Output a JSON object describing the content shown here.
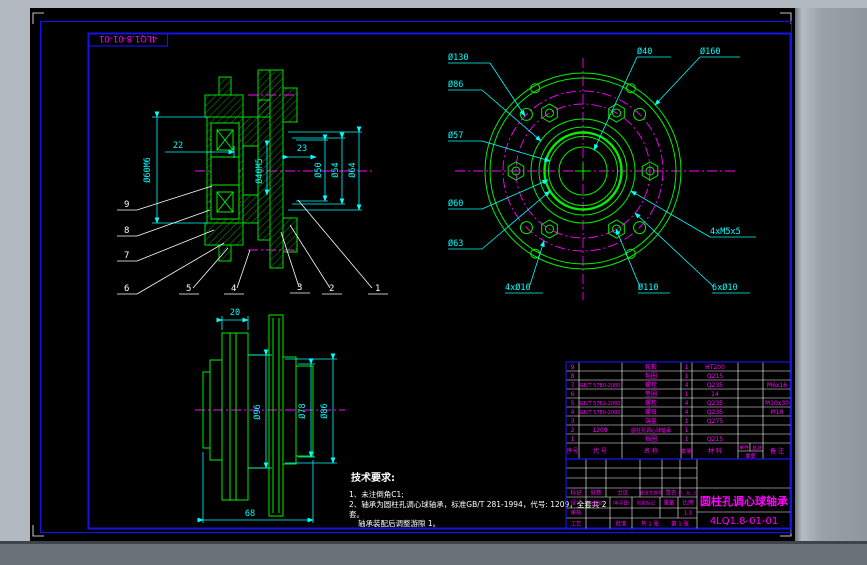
{
  "colors": {
    "line_green": "#00f000",
    "dim_cyan": "#00ffff",
    "center_magenta": "#ff00ff",
    "frame_blue": "#1414e6",
    "annotation_white": "#ffffff",
    "paper_black": "#000000",
    "chrome_gray": "#9aa1a8"
  },
  "frame": {
    "corner_number": "4LQ1.8-01-01"
  },
  "section_view": {
    "dims": {
      "width_22": "22",
      "width_23": "23",
      "bore_left": "Ø60M6",
      "bore_center": "Ø40M5",
      "d50": "Ø50",
      "d54": "Ø54",
      "d64": "Ø64"
    },
    "callouts": [
      "1",
      "2",
      "3",
      "4",
      "5",
      "6",
      "7",
      "8",
      "9"
    ]
  },
  "flange_view": {
    "labels": {
      "d130": "Ø130",
      "d86": "Ø86",
      "d57": "Ø57",
      "d60": "Ø60",
      "d63": "Ø63",
      "d40": "Ø40",
      "d160": "Ø160",
      "thread": "4xM5x5",
      "holes4": "4xØ10",
      "d110": "Ø110",
      "holes6": "6xØ10"
    }
  },
  "bottom_view": {
    "dims": {
      "w20": "20",
      "d96": "Ø96",
      "d78": "Ø78",
      "d86": "Ø86",
      "w68": "68"
    }
  },
  "notes": {
    "title": "技术要求:",
    "line1": "1、未注倒角C1;",
    "line2": "2、轴承为圆柱孔调心球轴承，标准GB/T 281-1994，代号: 1209，全套共 2",
    "line3": "套。",
    "line4": "轴承装配后调整游隙 1。"
  },
  "bom": {
    "headers": {
      "seq": "序号",
      "code": "代 号",
      "name": "名 称",
      "qty": "数量",
      "material": "材 料",
      "unit": "单件",
      "total": "总计",
      "weight": "重量",
      "remark": "备 注"
    },
    "rows": [
      {
        "seq": "9",
        "code": "",
        "name": "轮毂",
        "qty": "1",
        "material": "HT200",
        "remark": ""
      },
      {
        "seq": "8",
        "code": "",
        "name": "毡圈",
        "qty": "1",
        "material": "Q215",
        "remark": ""
      },
      {
        "seq": "7",
        "code": "GB/T 5780-2000",
        "name": "螺栓",
        "qty": "4",
        "material": "Q235",
        "remark": "M6x16"
      },
      {
        "seq": "6",
        "code": "",
        "name": "垫圈",
        "qty": "1",
        "material": "14",
        "remark": ""
      },
      {
        "seq": "5",
        "code": "GB/T 5782-2000",
        "name": "螺栓",
        "qty": "4",
        "material": "Q235",
        "remark": "M10x30"
      },
      {
        "seq": "4",
        "code": "GB/T 5780-2000",
        "name": "螺母",
        "qty": "4",
        "material": "Q235",
        "remark": "M10"
      },
      {
        "seq": "3",
        "code": "",
        "name": "端盖",
        "qty": "1",
        "material": "Q275",
        "remark": ""
      },
      {
        "seq": "2",
        "code": "1209",
        "name": "圆柱孔调心球轴承",
        "qty": "1",
        "material": "",
        "remark": ""
      },
      {
        "seq": "1",
        "code": "",
        "name": "挡圈",
        "qty": "1",
        "material": "Q215",
        "remark": ""
      }
    ]
  },
  "title_block": {
    "labels": {
      "mark": "标记",
      "count": "处数",
      "zone": "分区",
      "doc": "更改文件号",
      "sign": "签名",
      "date": "年、月、日",
      "design": "设计",
      "sign2": "(签名)",
      "date2": "(年月日)",
      "stage": "阶段标记",
      "weight": "重量",
      "scale": "比例",
      "check": "审核",
      "process": "工艺",
      "approve": "批准"
    },
    "scale_value": "1:1",
    "sheets": "共 1 张",
    "sheet_no": "第 1 张",
    "title": "圆柱孔调心球轴承",
    "drawing_number": "4LQ1.8-01-01"
  }
}
